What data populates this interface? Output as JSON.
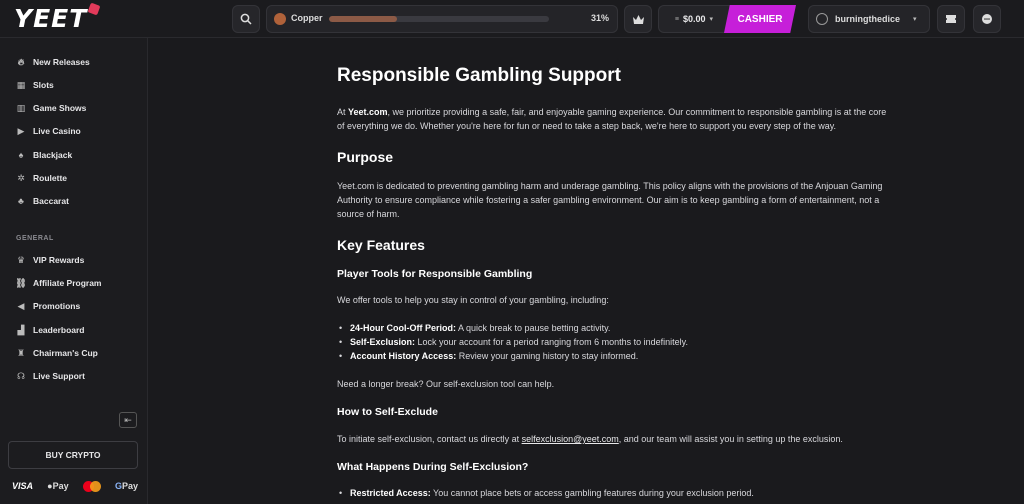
{
  "header": {
    "logo": "YEET",
    "tier": "Copper",
    "progress_percent_text": "31%",
    "progress_fraction": 0.31,
    "balance": "$0.00",
    "cashier_label": "CASHIER",
    "username": "burningthedice"
  },
  "sidebar": {
    "items": [
      {
        "label": "New Releases",
        "icon": "flame-icon"
      },
      {
        "label": "Slots",
        "icon": "slots-icon"
      },
      {
        "label": "Game Shows",
        "icon": "game-shows-icon"
      },
      {
        "label": "Live Casino",
        "icon": "live-casino-icon"
      },
      {
        "label": "Blackjack",
        "icon": "blackjack-icon"
      },
      {
        "label": "Roulette",
        "icon": "roulette-icon"
      },
      {
        "label": "Baccarat",
        "icon": "baccarat-icon"
      }
    ],
    "general_label": "GENERAL",
    "general_items": [
      {
        "label": "VIP Rewards",
        "icon": "crown-icon"
      },
      {
        "label": "Affiliate Program",
        "icon": "affiliate-icon"
      },
      {
        "label": "Promotions",
        "icon": "megaphone-icon"
      },
      {
        "label": "Leaderboard",
        "icon": "leaderboard-icon"
      },
      {
        "label": "Chairman's Cup",
        "icon": "trophy-icon"
      },
      {
        "label": "Live Support",
        "icon": "headset-icon"
      }
    ],
    "buy_crypto": "BUY CRYPTO",
    "payments": {
      "visa": "VISA",
      "apple_pay": "Pay",
      "google_pay": "Pay"
    }
  },
  "content": {
    "title": "Responsible Gambling Support",
    "intro_prefix": "At ",
    "intro_brand": "Yeet.com",
    "intro_rest": ", we prioritize providing a safe, fair, and enjoyable gaming experience. Our commitment to responsible gambling is at the core of everything we do. Whether you're here for fun or need to take a step back, we're here to support you every step of the way.",
    "purpose_heading": "Purpose",
    "purpose_text": "Yeet.com is dedicated to preventing gambling harm and underage gambling. This policy aligns with the provisions of the Anjouan Gaming Authority to ensure compliance while fostering a safer gambling environment. Our aim is to keep gambling a form of entertainment, not a source of harm.",
    "features_heading": "Key Features",
    "tools_heading": "Player Tools for Responsible Gambling",
    "tools_intro": "We offer tools to help you stay in control of your gambling, including:",
    "tools": [
      {
        "term": "24-Hour Cool-Off Period:",
        "desc": " A quick break to pause betting activity."
      },
      {
        "term": "Self-Exclusion:",
        "desc": " Lock your account for a period ranging from 6 months to indefinitely."
      },
      {
        "term": "Account History Access:",
        "desc": " Review your gaming history to stay informed."
      }
    ],
    "longer_break": "Need a longer break? Our self-exclusion tool can help.",
    "how_heading": "How to Self-Exclude",
    "how_prefix": "To initiate self-exclusion, contact us directly at ",
    "how_email": "selfexclusion@yeet.com",
    "how_suffix": ", and our team will assist you in setting up the exclusion.",
    "during_heading": "What Happens During Self-Exclusion?",
    "during_items": [
      {
        "term": "Restricted Access:",
        "desc": " You cannot place bets or access gambling features during your exclusion period."
      }
    ]
  }
}
